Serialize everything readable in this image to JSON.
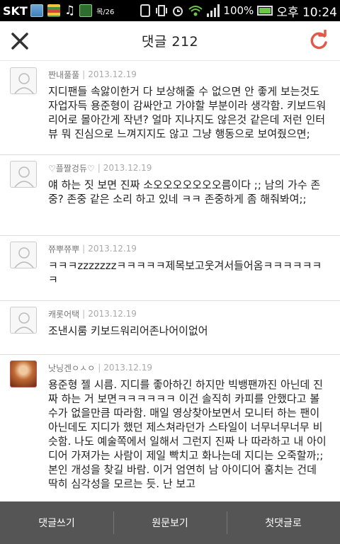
{
  "status_bar": {
    "carrier": "SKT",
    "date_badge": "목/26",
    "battery_pct": "100%",
    "time": "오후 10:24"
  },
  "header": {
    "title": "댓글 212",
    "close_icon": "close-icon",
    "refresh_icon": "refresh-icon",
    "accent_color": "#e05a4a"
  },
  "comments": [
    {
      "author": "짠내풀풀",
      "date": "2013.12.19",
      "body": "지디팬들 속앓이한거 다 보상해줄 수 없으면 안 좋게 보는것도 자업자득 용준형이 감싸안고 가야할 부분이라 생각함. 키보드워리어로 몰아간게 작년? 얼마 지나지도 않은것 같은데 저런 인터뷰 뭐 진심으로 느껴지지도 않고 그냥 행동으로 보여줬으면;",
      "avatar": "default"
    },
    {
      "author": "♡플짤겅듀♡",
      "date": "2013.12.19",
      "body": "얘 하는 짓 보면 진짜 소오오오오오오오름이다 ;; 남의 가수 존중? 존중 같은 소리 하고 있네 ㅋㅋ 존중하게 좀 해줘봐여;;",
      "avatar": "default"
    },
    {
      "author": "쮸뿌쮸뿌",
      "date": "2013.12.19",
      "body": "ㅋㅋㅋzzzzzzzㅋㅋㅋㅋㅋ제목보고웃겨서들어옴ㅋㅋㅋㅋㅋㅋㅋ",
      "avatar": "default"
    },
    {
      "author": "캐롯어택",
      "date": "2013.12.19",
      "body": "조낸시룸 키보드워리어존나어이없어",
      "avatar": "default"
    },
    {
      "author": "낫닝겐ㅇㅅㅇ",
      "date": "2013.12.19",
      "body": "용준형 젤 시름. 지디를 좋아하긴 하지만 빅뱅팬까진 아닌데 진짜 하는 거 보면ㅋㅋㅋㅋㅋㅋ 이건 솔직히 카피를 안했다고 볼수가 없을만큼 따라함. 매일 영상찾아보면서 모니터 하는 팬이 아닌데도 지디가 했던 제스쳐라던가 스타일이 너무너무너무 비슷함. 나도 예술쪽에서 일해서 그런지 진짜 나 따라하고 내 아이디어 가져가는 사람이 제일 빡치고 화나는데 지디는 오죽할까;; 본인 개성을 찾길 바람. 이거 엄연히 남 아이디어 훔치는 건데 딱히 심각성을 모르는 듯. 난 보고",
      "avatar": "photo"
    }
  ],
  "bottom_bar": {
    "write_comment": "댓글쓰기",
    "view_original": "원문보기",
    "first_comment": "첫댓글로"
  }
}
